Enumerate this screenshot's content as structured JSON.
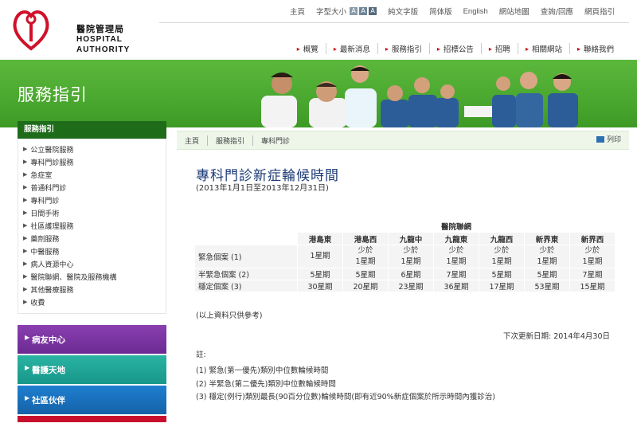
{
  "header": {
    "logo_zh": "醫院管理局",
    "logo_en_1": "HOSPITAL",
    "logo_en_2": "AUTHORITY",
    "util": {
      "home": "主頁",
      "font_size": "字型大小",
      "size_labels": [
        "A",
        "A",
        "A"
      ],
      "text_only": "純文字版",
      "simplified": "简体版",
      "english": "English",
      "sitemap": "網站地圖",
      "feedback": "查詢/回應",
      "site_index": "網頁指引"
    },
    "nav": [
      "概覽",
      "最新消息",
      "服務指引",
      "招標公告",
      "招聘",
      "相關網站",
      "聯絡我們"
    ]
  },
  "banner": {
    "title": "服務指引"
  },
  "sidebar": {
    "heading": "服務指引",
    "items": [
      "公立醫院服務",
      "專科門診服務",
      "急症室",
      "普通科門診",
      "專科門診",
      "日間手術",
      "社區護理服務",
      "藥劑服務",
      "中醫服務",
      "病人資源中心",
      "醫院聯網、醫院及服務機構",
      "其他醫療服務",
      "收費"
    ],
    "boxes": [
      "病友中心",
      "醫護天地",
      "社區伙伴"
    ]
  },
  "content": {
    "breadcrumb": [
      "主頁",
      "服務指引",
      "專科門診"
    ],
    "print_label": "列印",
    "title": "專科門診新症輪候時間",
    "subtitle": "(2013年1月1日至2013年12月31日)",
    "table": {
      "caption": "醫院聯網",
      "columns": [
        "港島東",
        "港島西",
        "九龍中",
        "九龍東",
        "九龍西",
        "新界東",
        "新界西"
      ],
      "rows": [
        {
          "label": "緊急個案 (1)",
          "cells": [
            [
              "1星期"
            ],
            [
              "少於",
              "1星期"
            ],
            [
              "少於",
              "1星期"
            ],
            [
              "少於",
              "1星期"
            ],
            [
              "少於",
              "1星期"
            ],
            [
              "少於",
              "1星期"
            ],
            [
              "少於",
              "1星期"
            ]
          ]
        },
        {
          "label": "半緊急個案 (2)",
          "cells": [
            [
              "5星期"
            ],
            [
              "5星期"
            ],
            [
              "6星期"
            ],
            [
              "7星期"
            ],
            [
              "5星期"
            ],
            [
              "5星期"
            ],
            [
              "7星期"
            ]
          ]
        },
        {
          "label": "穩定個案 (3)",
          "cells": [
            [
              "30星期"
            ],
            [
              "20星期"
            ],
            [
              "23星期"
            ],
            [
              "36星期"
            ],
            [
              "17星期"
            ],
            [
              "53星期"
            ],
            [
              "15星期"
            ]
          ]
        }
      ]
    },
    "note_ref": "(以上資料只供參考)",
    "update": "下次更新日期: 2014年4月30日",
    "notes_heading": "註:",
    "notes": [
      "(1) 緊急(第一優先)類別中位數輪候時間",
      "(2) 半緊急(第二優先)類別中位數輪候時間",
      "(3) 穩定(例行)類別最長(90百分位數)輪候時間(即有近90%新症個案於所示時間內獲診治)"
    ]
  }
}
